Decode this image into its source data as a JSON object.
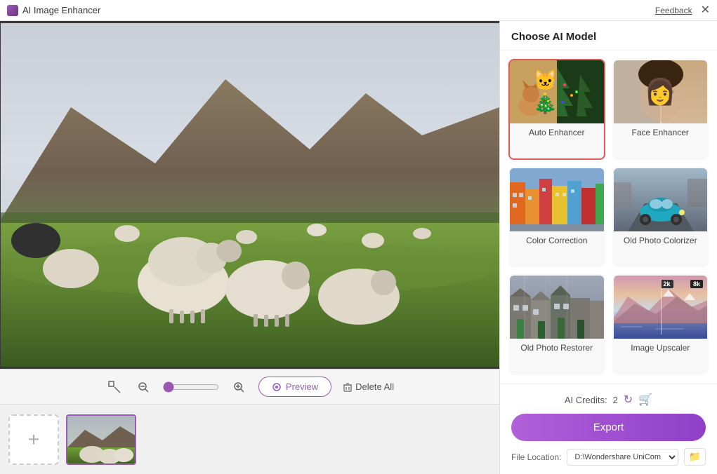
{
  "titlebar": {
    "app_name": "AI Image Enhancer",
    "feedback_label": "Feedback"
  },
  "toolbar": {
    "preview_label": "Preview",
    "delete_all_label": "Delete All",
    "zoom_value": 0
  },
  "right_panel": {
    "header": "Choose AI Model",
    "models": [
      {
        "id": "auto-enhancer",
        "label": "Auto Enhancer",
        "selected": true,
        "thumb_class": "thumb-auto"
      },
      {
        "id": "face-enhancer",
        "label": "Face Enhancer",
        "selected": false,
        "thumb_class": "thumb-face"
      },
      {
        "id": "color-correction",
        "label": "Color Correction",
        "selected": false,
        "thumb_class": "thumb-color"
      },
      {
        "id": "old-photo-colorizer",
        "label": "Old Photo Colorizer",
        "selected": false,
        "thumb_class": "thumb-colorizer"
      },
      {
        "id": "old-photo-restorer",
        "label": "Old Photo Restorer",
        "selected": false,
        "thumb_class": "thumb-restorer"
      },
      {
        "id": "image-upscaler",
        "label": "Image Upscaler",
        "selected": false,
        "thumb_class": "thumb-upscaler"
      }
    ],
    "credits_label": "AI Credits:",
    "credits_value": "2",
    "export_label": "Export",
    "file_location_label": "File Location:",
    "file_location_value": "D:\\Wondershare UniCom"
  }
}
